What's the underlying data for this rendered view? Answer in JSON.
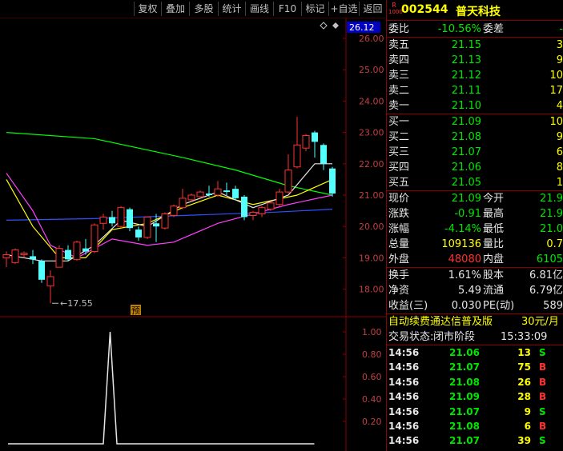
{
  "toolbar": {
    "buttons": [
      "复权",
      "叠加",
      "多股",
      "统计",
      "画线",
      "F10",
      "标记",
      "+自选",
      "返回"
    ]
  },
  "stock": {
    "badge_top": "R",
    "badge_bottom": "1000",
    "code": "002544",
    "name": "普天科技"
  },
  "main_chart": {
    "current_price_label": "26.12",
    "price_axis": [
      "26.00",
      "25.00",
      "24.00",
      "23.00",
      "22.00",
      "21.00",
      "20.00",
      "19.00",
      "18.00"
    ],
    "low_marker": "17.55",
    "event_marker": "预",
    "colors": {
      "up": "#ff3232",
      "down": "#54ffff",
      "ma5": "#e6e6e6",
      "ma10": "#ffff00",
      "ma20": "#ff40ff",
      "ma60": "#00ff00",
      "ma120": "#3050ff"
    },
    "candles": [
      {
        "o": 19.0,
        "c": 19.1,
        "h": 19.2,
        "l": 18.7
      },
      {
        "o": 18.85,
        "c": 19.25,
        "h": 19.3,
        "l": 18.8
      },
      {
        "o": 19.1,
        "c": 19.15,
        "h": 19.2,
        "l": 19.0
      },
      {
        "o": 19.05,
        "c": 18.95,
        "h": 19.25,
        "l": 18.8
      },
      {
        "o": 18.9,
        "c": 18.3,
        "h": 18.95,
        "l": 18.2
      },
      {
        "o": 18.1,
        "c": 18.4,
        "h": 18.6,
        "l": 17.55
      },
      {
        "o": 18.7,
        "c": 19.3,
        "h": 19.4,
        "l": 18.7
      },
      {
        "o": 19.25,
        "c": 18.95,
        "h": 19.4,
        "l": 18.9
      },
      {
        "o": 18.95,
        "c": 19.5,
        "h": 19.55,
        "l": 18.9
      },
      {
        "o": 19.3,
        "c": 19.2,
        "h": 19.6,
        "l": 19.1
      },
      {
        "o": 19.2,
        "c": 20.05,
        "h": 20.1,
        "l": 19.15
      },
      {
        "o": 20.1,
        "c": 20.3,
        "h": 20.4,
        "l": 19.9
      },
      {
        "o": 20.3,
        "c": 20.1,
        "h": 20.5,
        "l": 20.0
      },
      {
        "o": 20.0,
        "c": 20.6,
        "h": 20.65,
        "l": 19.95
      },
      {
        "o": 20.55,
        "c": 19.95,
        "h": 20.6,
        "l": 19.85
      },
      {
        "o": 19.9,
        "c": 19.65,
        "h": 20.0,
        "l": 19.55
      },
      {
        "o": 19.65,
        "c": 20.3,
        "h": 20.3,
        "l": 19.6
      },
      {
        "o": 20.1,
        "c": 20.0,
        "h": 20.4,
        "l": 19.5
      },
      {
        "o": 19.95,
        "c": 20.4,
        "h": 20.45,
        "l": 19.9
      },
      {
        "o": 20.35,
        "c": 20.65,
        "h": 20.7,
        "l": 20.3
      },
      {
        "o": 20.6,
        "c": 20.9,
        "h": 21.2,
        "l": 20.55
      },
      {
        "o": 20.85,
        "c": 21.0,
        "h": 21.05,
        "l": 20.8
      },
      {
        "o": 20.95,
        "c": 21.1,
        "h": 21.15,
        "l": 20.9
      },
      {
        "o": 21.05,
        "c": 21.0,
        "h": 21.3,
        "l": 20.95
      },
      {
        "o": 21.0,
        "c": 21.2,
        "h": 21.45,
        "l": 20.95
      },
      {
        "o": 21.15,
        "c": 21.1,
        "h": 21.4,
        "l": 21.0
      },
      {
        "o": 21.2,
        "c": 20.9,
        "h": 21.3,
        "l": 20.85
      },
      {
        "o": 20.95,
        "c": 20.3,
        "h": 21.0,
        "l": 20.2
      },
      {
        "o": 20.35,
        "c": 20.45,
        "h": 20.5,
        "l": 20.2
      },
      {
        "o": 20.4,
        "c": 20.6,
        "h": 20.65,
        "l": 20.3
      },
      {
        "o": 20.55,
        "c": 20.75,
        "h": 20.8,
        "l": 20.5
      },
      {
        "o": 20.7,
        "c": 21.1,
        "h": 21.2,
        "l": 20.65
      },
      {
        "o": 21.1,
        "c": 21.8,
        "h": 22.3,
        "l": 21.05
      },
      {
        "o": 21.9,
        "c": 22.6,
        "h": 23.5,
        "l": 21.85
      },
      {
        "o": 22.5,
        "c": 22.9,
        "h": 22.95,
        "l": 22.4
      },
      {
        "o": 23.0,
        "c": 22.7,
        "h": 23.05,
        "l": 22.2
      },
      {
        "o": 22.6,
        "c": 22.0,
        "h": 22.65,
        "l": 21.8
      },
      {
        "o": 21.85,
        "c": 21.05,
        "h": 21.9,
        "l": 20.95
      }
    ],
    "ma60_points": [
      [
        0,
        23.0
      ],
      [
        10,
        22.8
      ],
      [
        20,
        22.2
      ],
      [
        26,
        21.8
      ],
      [
        32,
        21.3
      ],
      [
        37,
        21.0
      ]
    ],
    "ma120_points": [
      [
        0,
        20.2
      ],
      [
        10,
        20.25
      ],
      [
        20,
        20.35
      ],
      [
        30,
        20.45
      ],
      [
        37,
        20.55
      ]
    ],
    "ma20_points": [
      [
        0,
        21.7
      ],
      [
        3,
        20.5
      ],
      [
        5,
        19.4
      ],
      [
        8,
        19.0
      ],
      [
        12,
        19.6
      ],
      [
        16,
        19.4
      ],
      [
        19,
        19.5
      ],
      [
        24,
        20.1
      ],
      [
        28,
        20.4
      ],
      [
        32,
        20.7
      ],
      [
        37,
        21.0
      ]
    ],
    "ma10_points": [
      [
        0,
        21.5
      ],
      [
        3,
        20.0
      ],
      [
        6,
        19.0
      ],
      [
        9,
        19.0
      ],
      [
        12,
        19.9
      ],
      [
        16,
        20.1
      ],
      [
        20,
        20.6
      ],
      [
        24,
        21.0
      ],
      [
        28,
        20.7
      ],
      [
        33,
        21.0
      ],
      [
        37,
        21.5
      ]
    ],
    "ma5_points": [
      [
        0,
        19.1
      ],
      [
        4,
        18.9
      ],
      [
        7,
        18.9
      ],
      [
        10,
        19.4
      ],
      [
        13,
        20.2
      ],
      [
        16,
        20.0
      ],
      [
        20,
        20.7
      ],
      [
        24,
        21.1
      ],
      [
        28,
        20.6
      ],
      [
        32,
        21.0
      ],
      [
        35,
        22.0
      ],
      [
        37,
        22.0
      ]
    ]
  },
  "sub_chart": {
    "axis": [
      "1.00",
      "0.80",
      "0.60",
      "0.40",
      "0.20"
    ],
    "values": [
      0,
      0,
      0,
      0,
      0,
      0,
      0,
      0,
      0,
      0,
      0,
      0,
      0,
      0,
      0,
      1,
      0,
      0,
      0,
      0,
      0,
      0,
      0,
      0,
      0,
      0,
      0,
      0,
      0,
      0,
      0,
      0,
      0,
      0,
      0,
      0,
      0,
      0,
      0,
      0,
      0,
      0,
      0,
      0,
      0,
      0
    ]
  },
  "quote": {
    "weibi_label": "委比",
    "weibi_value": "-10.56%",
    "weicha_label": "委差",
    "weicha_value": "-",
    "sell": [
      {
        "label": "卖五",
        "price": "21.15",
        "vol": "3"
      },
      {
        "label": "卖四",
        "price": "21.13",
        "vol": "9"
      },
      {
        "label": "卖三",
        "price": "21.12",
        "vol": "10"
      },
      {
        "label": "卖二",
        "price": "21.11",
        "vol": "17"
      },
      {
        "label": "卖一",
        "price": "21.10",
        "vol": "4"
      }
    ],
    "buy": [
      {
        "label": "买一",
        "price": "21.09",
        "vol": "10"
      },
      {
        "label": "买二",
        "price": "21.08",
        "vol": "9"
      },
      {
        "label": "买三",
        "price": "21.07",
        "vol": "6"
      },
      {
        "label": "买四",
        "price": "21.06",
        "vol": "8"
      },
      {
        "label": "买五",
        "price": "21.05",
        "vol": "1"
      }
    ],
    "stats": [
      {
        "l1": "现价",
        "v1": "21.09",
        "c1": "green",
        "l2": "今开",
        "v2": "21.9",
        "c2": "green"
      },
      {
        "l1": "涨跌",
        "v1": "-0.91",
        "c1": "green",
        "l2": "最高",
        "v2": "21.9",
        "c2": "green"
      },
      {
        "l1": "涨幅",
        "v1": "-4.14%",
        "c1": "green",
        "l2": "最低",
        "v2": "21.0",
        "c2": "green"
      },
      {
        "l1": "总量",
        "v1": "109136",
        "c1": "yellow",
        "l2": "量比",
        "v2": "0.7",
        "c2": "yellow"
      },
      {
        "l1": "外盘",
        "v1": "48080",
        "c1": "red",
        "l2": "内盘",
        "v2": "6105",
        "c2": "green"
      }
    ],
    "fund": [
      {
        "l1": "换手",
        "v1": "1.61%",
        "l2": "股本",
        "v2": "6.81亿"
      },
      {
        "l1": "净资",
        "v1": "5.49",
        "l2": "流通",
        "v2": "6.79亿"
      },
      {
        "l1": "收益(三)",
        "v1": "0.030",
        "l2": "PE(动)",
        "v2": "589"
      }
    ],
    "promo_text": "自动续费通达信普及版",
    "promo_price": "30元/月",
    "status_label": "交易状态:",
    "status_value": "闭市阶段",
    "status_time": "15:33:09"
  },
  "ticks": [
    {
      "time": "14:56",
      "price": "21.06",
      "vol": "13",
      "side": "S"
    },
    {
      "time": "14:56",
      "price": "21.07",
      "vol": "75",
      "side": "B"
    },
    {
      "time": "14:56",
      "price": "21.08",
      "vol": "26",
      "side": "B"
    },
    {
      "time": "14:56",
      "price": "21.09",
      "vol": "28",
      "side": "B"
    },
    {
      "time": "14:56",
      "price": "21.07",
      "vol": "9",
      "side": "S"
    },
    {
      "time": "14:56",
      "price": "21.08",
      "vol": "6",
      "side": "B"
    },
    {
      "time": "14:56",
      "price": "21.07",
      "vol": "39",
      "side": "S"
    }
  ]
}
